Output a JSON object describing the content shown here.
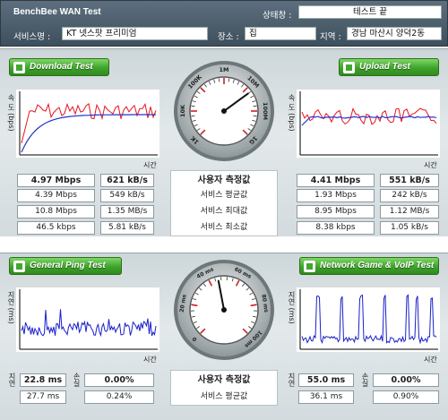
{
  "header": {
    "title": "BenchBee WAN Test",
    "status_label": "상태창 :",
    "status_value": "테스트 끝",
    "service_label": "서비스명 :",
    "service_value": "KT 넷스팟 프리미엄",
    "place_label": "장소 :",
    "place_value": "집",
    "region_label": "지역 :",
    "region_value": "경남 마산시 양덕2동"
  },
  "download": {
    "button": "Download Test",
    "ylabel": "속 도 (bps)",
    "xlabel": "시간",
    "rows": [
      {
        "mbps": "4.97 Mbps",
        "kbs": "621 kB/s"
      },
      {
        "mbps": "4.39 Mbps",
        "kbs": "549 kB/s"
      },
      {
        "mbps": "10.8 Mbps",
        "kbs": "1.35 MB/s"
      },
      {
        "mbps": "46.5 kbps",
        "kbs": "5.81 kB/s"
      }
    ]
  },
  "upload": {
    "button": "Upload Test",
    "ylabel": "속 도 (bps)",
    "xlabel": "시간",
    "rows": [
      {
        "mbps": "4.41 Mbps",
        "kbs": "551 kB/s"
      },
      {
        "mbps": "1.93 Mbps",
        "kbs": "242 kB/s"
      },
      {
        "mbps": "8.95 Mbps",
        "kbs": "1.12 MB/s"
      },
      {
        "mbps": "8.38 kbps",
        "kbs": "1.05 kB/s"
      }
    ]
  },
  "stats_labels": [
    "사용자 측정값",
    "서비스 평균값",
    "서비스 최대값",
    "서비스 최소값"
  ],
  "speed_gauge": {
    "ticks": [
      "1K",
      "10K",
      "100K",
      "1M",
      "10M",
      "100M",
      "1G"
    ],
    "needle_value": "10M"
  },
  "ping": {
    "button": "General Ping Test",
    "ylabel": "지연 (ms)",
    "xlabel": "시간",
    "delay_label": "지연",
    "loss_label": "손실",
    "rows": [
      {
        "delay": "22.8 ms",
        "loss": "0.00%"
      },
      {
        "delay": "27.7 ms",
        "loss": "0.24%"
      }
    ]
  },
  "game": {
    "button": "Network Game & VoIP Test",
    "ylabel": "지연 (ms)",
    "xlabel": "시간",
    "delay_label": "지연",
    "loss_label": "손실",
    "rows": [
      {
        "delay": "55.0 ms",
        "loss": "0.00%"
      },
      {
        "delay": "36.1 ms",
        "loss": "0.90%"
      }
    ]
  },
  "bottom_labels": [
    "사용자 측정값",
    "서비스 평균값"
  ],
  "ping_gauge": {
    "ticks": [
      "0",
      "20 ms",
      "40 ms",
      "60 ms",
      "80 ms",
      "100 ms"
    ],
    "needle_value": "50 ms"
  }
}
